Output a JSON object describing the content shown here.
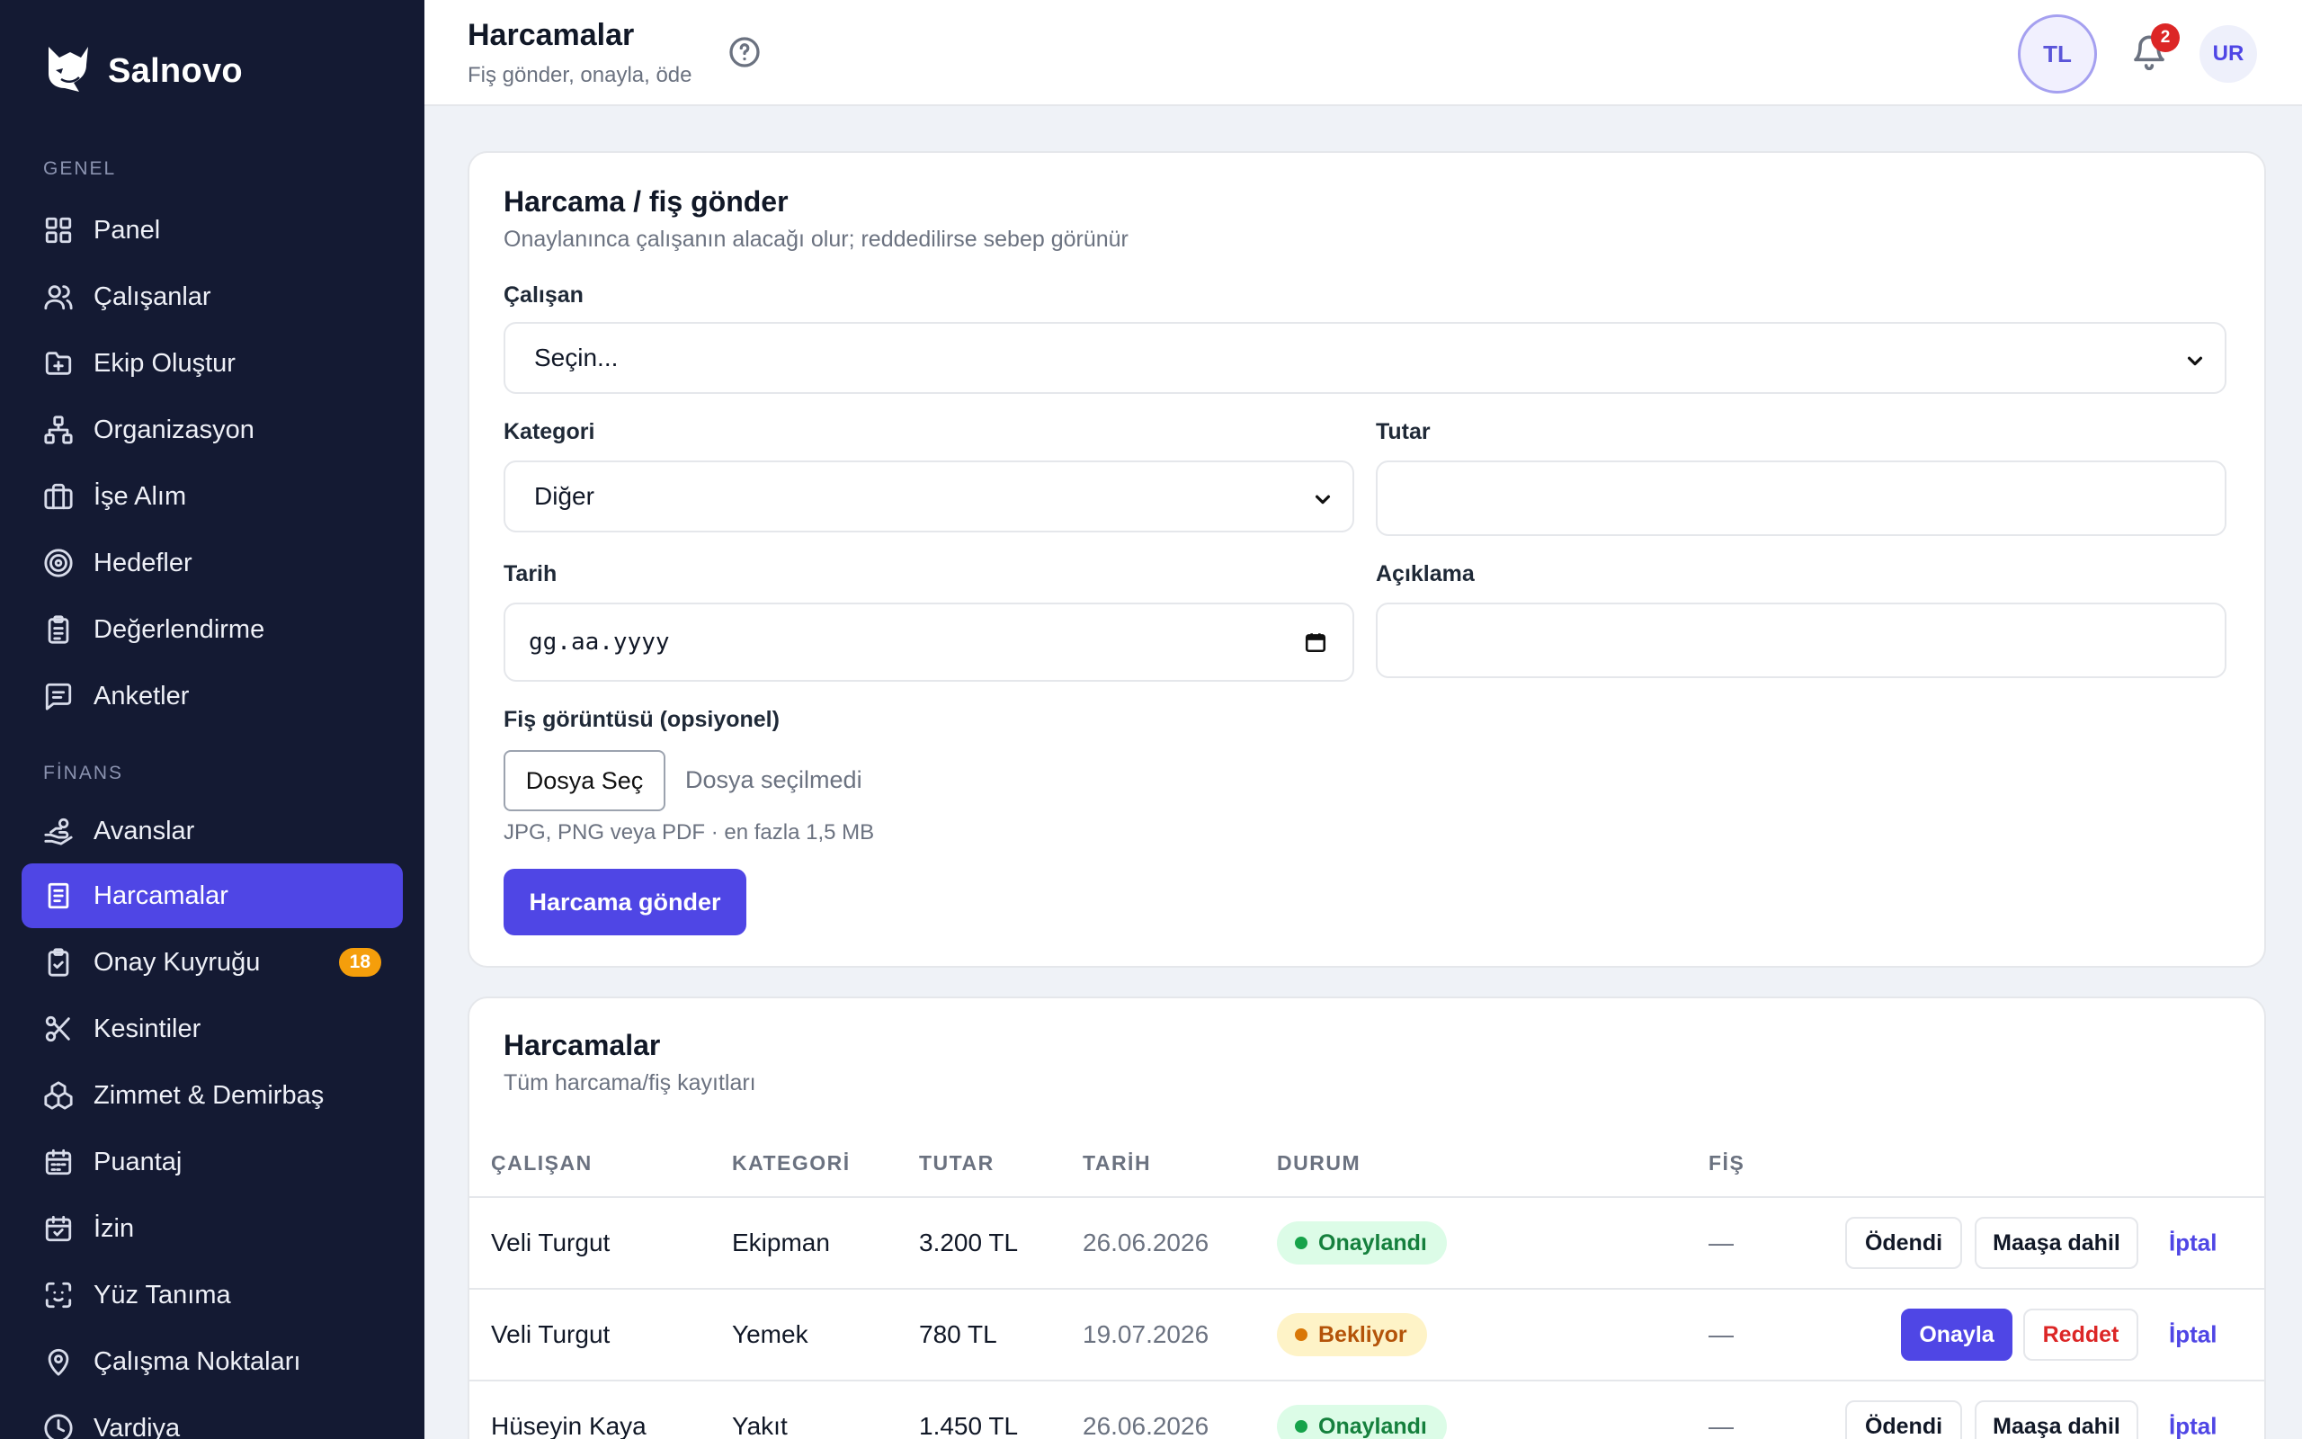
{
  "brand": {
    "name": "Salnovo"
  },
  "sidebar": {
    "sections": [
      {
        "label": "GENEL"
      },
      {
        "label": "FİNANS"
      }
    ],
    "items": [
      {
        "label": "Panel",
        "icon": "grid-icon"
      },
      {
        "label": "Çalışanlar",
        "icon": "users-icon"
      },
      {
        "label": "Ekip Oluştur",
        "icon": "folder-plus-icon"
      },
      {
        "label": "Organizasyon",
        "icon": "org-chart-icon"
      },
      {
        "label": "İşe Alım",
        "icon": "briefcase-icon"
      },
      {
        "label": "Hedefler",
        "icon": "target-icon"
      },
      {
        "label": "Değerlendirme",
        "icon": "clipboard-icon"
      },
      {
        "label": "Anketler",
        "icon": "message-icon"
      },
      {
        "label": "Avanslar",
        "icon": "hand-coins-icon"
      },
      {
        "label": "Harcamalar",
        "icon": "receipt-icon",
        "active": true
      },
      {
        "label": "Onay Kuyruğu",
        "icon": "clipboard-check-icon",
        "badge": "18"
      },
      {
        "label": "Kesintiler",
        "icon": "scissors-icon"
      },
      {
        "label": "Zimmet & Demirbaş",
        "icon": "boxes-icon"
      },
      {
        "label": "Puantaj",
        "icon": "calendar-grid-icon"
      },
      {
        "label": "İzin",
        "icon": "calendar-check-icon"
      },
      {
        "label": "Yüz Tanıma",
        "icon": "face-scan-icon"
      },
      {
        "label": "Çalışma Noktaları",
        "icon": "map-pin-icon"
      },
      {
        "label": "Vardiya",
        "icon": "clock-icon"
      }
    ]
  },
  "header": {
    "title": "Harcamalar",
    "subtitle": "Fiş gönder, onayla, öde",
    "lang": "TL",
    "notifications": "2",
    "avatar": "UR"
  },
  "form": {
    "title": "Harcama / fiş gönder",
    "subtitle": "Onaylanınca çalışanın alacağı olur; reddedilirse sebep görünür",
    "employee_label": "Çalışan",
    "employee_value": "Seçin...",
    "category_label": "Kategori",
    "category_value": "Diğer",
    "amount_label": "Tutar",
    "amount_value": "",
    "date_label": "Tarih",
    "date_value": "gg.aa.yyyy",
    "desc_label": "Açıklama",
    "desc_value": "",
    "file_label": "Fiş görüntüsü (opsiyonel)",
    "file_button": "Dosya Seç",
    "file_none": "Dosya seçilmedi",
    "file_hint": "JPG, PNG veya PDF · en fazla 1,5 MB",
    "submit": "Harcama gönder"
  },
  "list": {
    "title": "Harcamalar",
    "subtitle": "Tüm harcama/fiş kayıtları",
    "columns": [
      "ÇALIŞAN",
      "KATEGORİ",
      "TUTAR",
      "TARİH",
      "DURUM",
      "FİŞ"
    ],
    "rows": [
      {
        "employee": "Veli Turgut",
        "category": "Ekipman",
        "amount": "3.200 TL",
        "date": "26.06.2026",
        "status": "Onaylandı",
        "receipt": "—",
        "actions": [
          "Ödendi",
          "Maaşa dahil"
        ],
        "link": "İptal"
      },
      {
        "employee": "Veli Turgut",
        "category": "Yemek",
        "amount": "780 TL",
        "date": "19.07.2026",
        "status": "Bekliyor",
        "receipt": "—",
        "actions": [
          "Onayla",
          "Reddet"
        ],
        "link": "İptal"
      },
      {
        "employee": "Hüseyin Kaya",
        "category": "Yakıt",
        "amount": "1.450 TL",
        "date": "26.06.2026",
        "status": "Onaylandı",
        "receipt": "—",
        "actions": [
          "Ödendi",
          "Maaşa dahil"
        ],
        "link": "İptal"
      }
    ]
  },
  "colors": {
    "accent": "#4f46e5",
    "sidebar": "#141a33",
    "success": "#15803d",
    "warning": "#b45309",
    "danger": "#dc2626"
  }
}
